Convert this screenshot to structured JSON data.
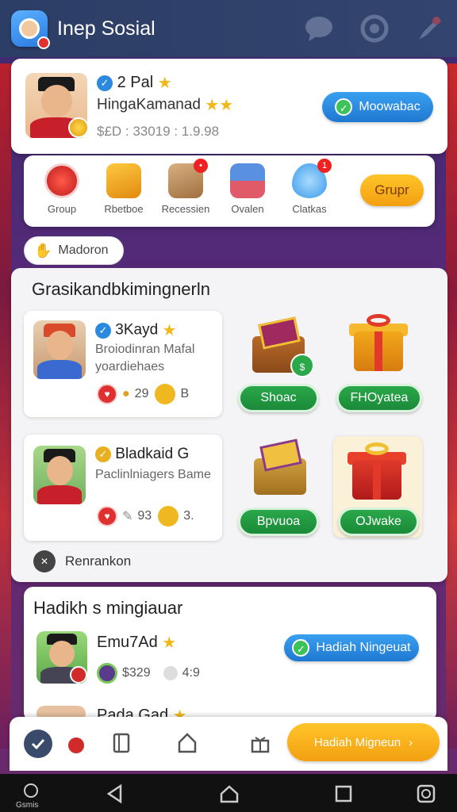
{
  "app": {
    "title": "Inep Sosial"
  },
  "top_icons": [
    "chat-icon",
    "at-icon",
    "rocket-icon"
  ],
  "profile": {
    "name": "2 Pal",
    "subtitle": "HingaKamanad",
    "stats": "$£D : 33019 : 1.9.98",
    "button": "Moowabac"
  },
  "actions": {
    "items": [
      {
        "label": "Group",
        "icon": "thumb-icon",
        "color": "#e03a30"
      },
      {
        "label": "Rbetboe",
        "icon": "box-icon",
        "color": "#f0a020"
      },
      {
        "label": "Recessien",
        "icon": "gift-crate-icon",
        "color": "#c09060",
        "badge": "•"
      },
      {
        "label": "Ovalen",
        "icon": "cube-icon",
        "color": "#4a80d0"
      },
      {
        "label": "Clatkas",
        "icon": "heart-shield-icon",
        "color": "#5ab0f0",
        "badge": "1"
      }
    ],
    "button": "Grupr"
  },
  "chip": {
    "label": "Madoron"
  },
  "section1": {
    "title": "Grasikandbkimingnerln",
    "items": [
      {
        "name": "3Kayd",
        "line1": "Broiodinran Mafal",
        "line2": "yoardiehaes",
        "stat1": "29",
        "stat2": "B",
        "reward_button": "Shoac",
        "reward2_button": "FHOyatea"
      },
      {
        "name": "Bladkaid G",
        "line1": "Paclinlniagers Bame",
        "stat1": "93",
        "stat2": "3.",
        "reward_button": "Bpvuoa",
        "reward2_button": "OJwake"
      }
    ],
    "footer": "Renrankon"
  },
  "section2": {
    "title": "Hadikh s mingiauar",
    "items": [
      {
        "name": "Emu7Ad",
        "stat1": "$329",
        "stat2": "4:9",
        "button": "Hadiah Ningeuat"
      },
      {
        "name": "Pada Gad"
      }
    ]
  },
  "tabbar": {
    "cta": "Hadiah Migneun"
  },
  "navbar": {
    "label": "Gsmis"
  }
}
